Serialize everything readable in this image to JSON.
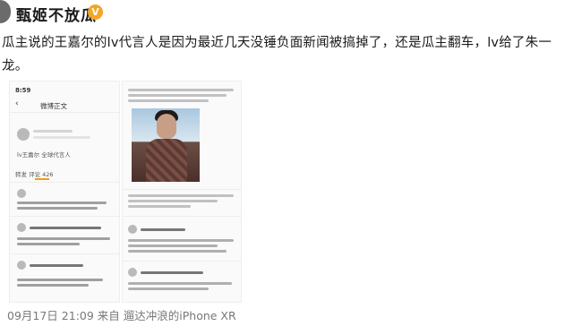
{
  "post": {
    "username": "甄姬不放瓜",
    "verified_icon": "verified-badge-icon",
    "text": "瓜主说的王嘉尔的lv代言人是因为最近几天没锤负面新闻被搞掉了，还是瓜主翻车，lv给了朱一龙。",
    "meta": "09月17日 21:09  来自 遛达冲浪的iPhone XR"
  },
  "embedded_screenshot": {
    "status_time": "8:59",
    "nav_title": "微博正文",
    "quoted_text": "lv王嘉尔 全球代言人",
    "tabs": "转发 评论 426",
    "colors": {
      "accent": "#f39c12",
      "verified": "#f5a623"
    }
  }
}
